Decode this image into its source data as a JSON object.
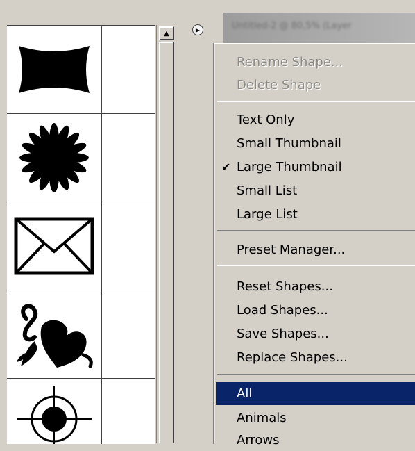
{
  "document": {
    "title": "Untitled-2 @ 80,5% (Layer"
  },
  "shapes": [
    {
      "name": "banner"
    },
    {
      "name": "starburst"
    },
    {
      "name": "envelope"
    },
    {
      "name": "heart-leaf"
    },
    {
      "name": "target"
    }
  ],
  "menu": {
    "items": [
      {
        "label": "Rename Shape...",
        "disabled": true
      },
      {
        "label": "Delete Shape",
        "disabled": true
      },
      {
        "label": "Text Only"
      },
      {
        "label": "Small Thumbnail"
      },
      {
        "label": "Large Thumbnail",
        "checked": true,
        "check": "✔"
      },
      {
        "label": "Small List"
      },
      {
        "label": "Large List"
      },
      {
        "label": "Preset Manager..."
      },
      {
        "label": "Reset Shapes..."
      },
      {
        "label": "Load Shapes..."
      },
      {
        "label": "Save Shapes..."
      },
      {
        "label": "Replace Shapes..."
      },
      {
        "label": "All",
        "selected": true
      },
      {
        "label": "Animals"
      },
      {
        "label": "Arrows"
      }
    ]
  },
  "colors": {
    "menu_bg": "#d4d0c8",
    "highlight": "#0a246a",
    "disabled_text": "#8c8a85"
  }
}
